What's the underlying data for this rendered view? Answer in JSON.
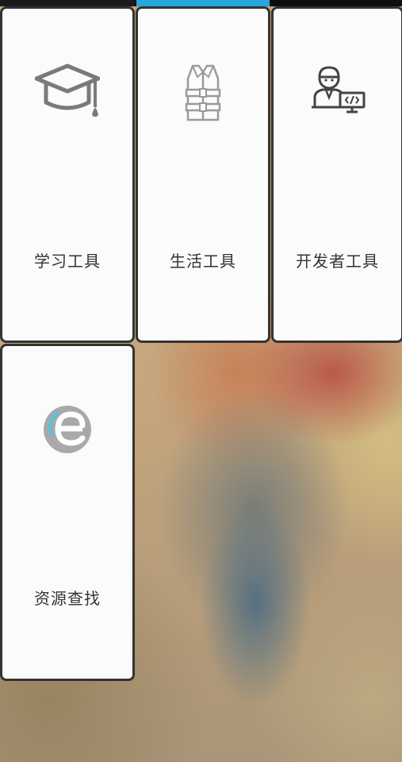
{
  "tiles": [
    {
      "label": "学习工具",
      "icon": "graduation-cap-icon"
    },
    {
      "label": "生活工具",
      "icon": "life-vest-icon"
    },
    {
      "label": "开发者工具",
      "icon": "developer-icon"
    },
    {
      "label": "资源查找",
      "icon": "browser-e-icon"
    }
  ],
  "colors": {
    "accent": "#29a6dc",
    "tile_bg": "#fbfbfb",
    "tile_border": "#333333",
    "icon_gray": "#7a7a7a"
  }
}
